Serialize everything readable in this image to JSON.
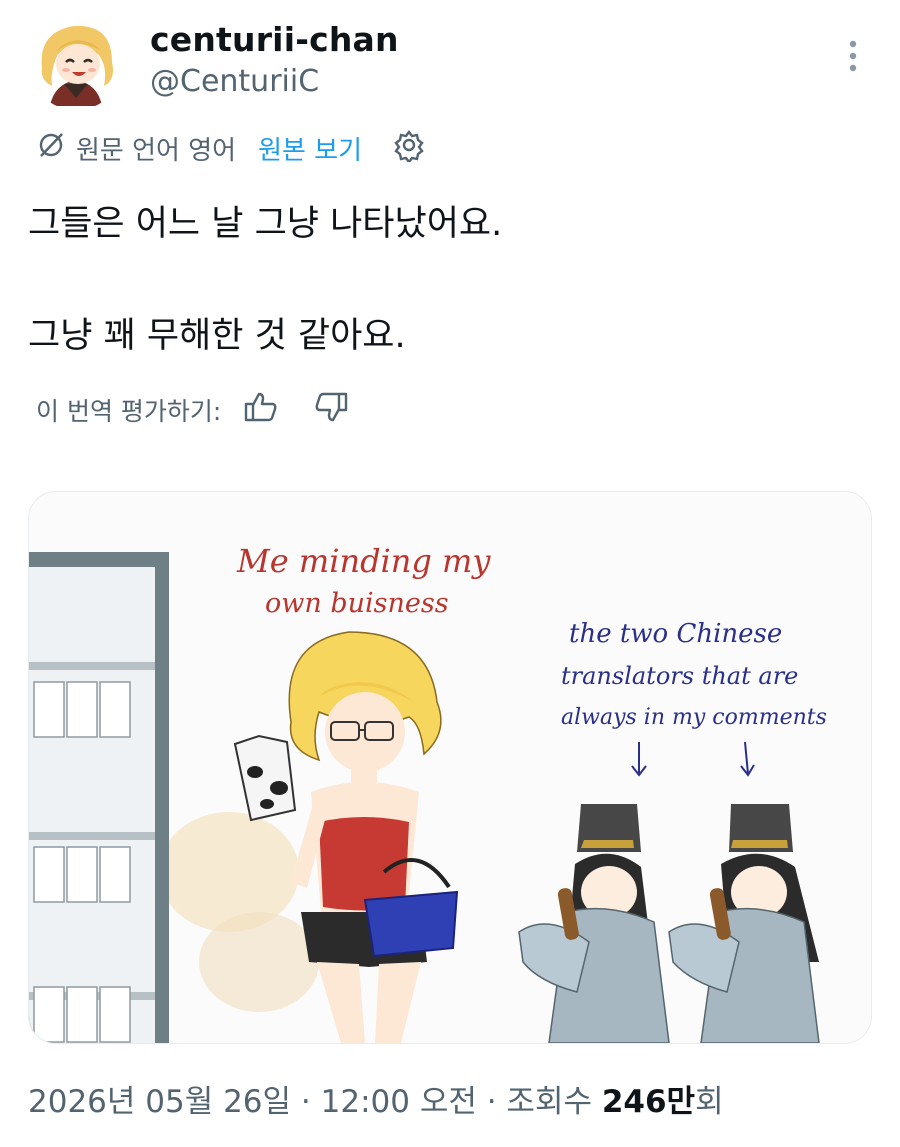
{
  "author": {
    "display_name": "centurii-chan",
    "handle": "@CenturiiC"
  },
  "translation": {
    "source_label": "원문 언어 영어",
    "show_original": "원본 보기"
  },
  "tweet": {
    "lines": [
      "그들은 어느 날 그냥 나타났어요.",
      "그냥 꽤 무해한 것 같아요."
    ]
  },
  "rate_translation": {
    "label": "이 번역 평가하기:"
  },
  "media": {
    "caption_left": [
      "Me minding my",
      "own buisness"
    ],
    "caption_right": [
      "the two Chinese",
      "translators that are",
      "always in my comments"
    ]
  },
  "footer": {
    "date": "2026년 05월 26일",
    "sep1": " · ",
    "time": "12:00 오전",
    "sep2": " · ",
    "views_prefix": "조회수 ",
    "views_num": "246만",
    "views_suffix": "회"
  },
  "colors": {
    "accent": "#1d9bf0",
    "text": "#0f1419",
    "secondary": "#536471"
  }
}
